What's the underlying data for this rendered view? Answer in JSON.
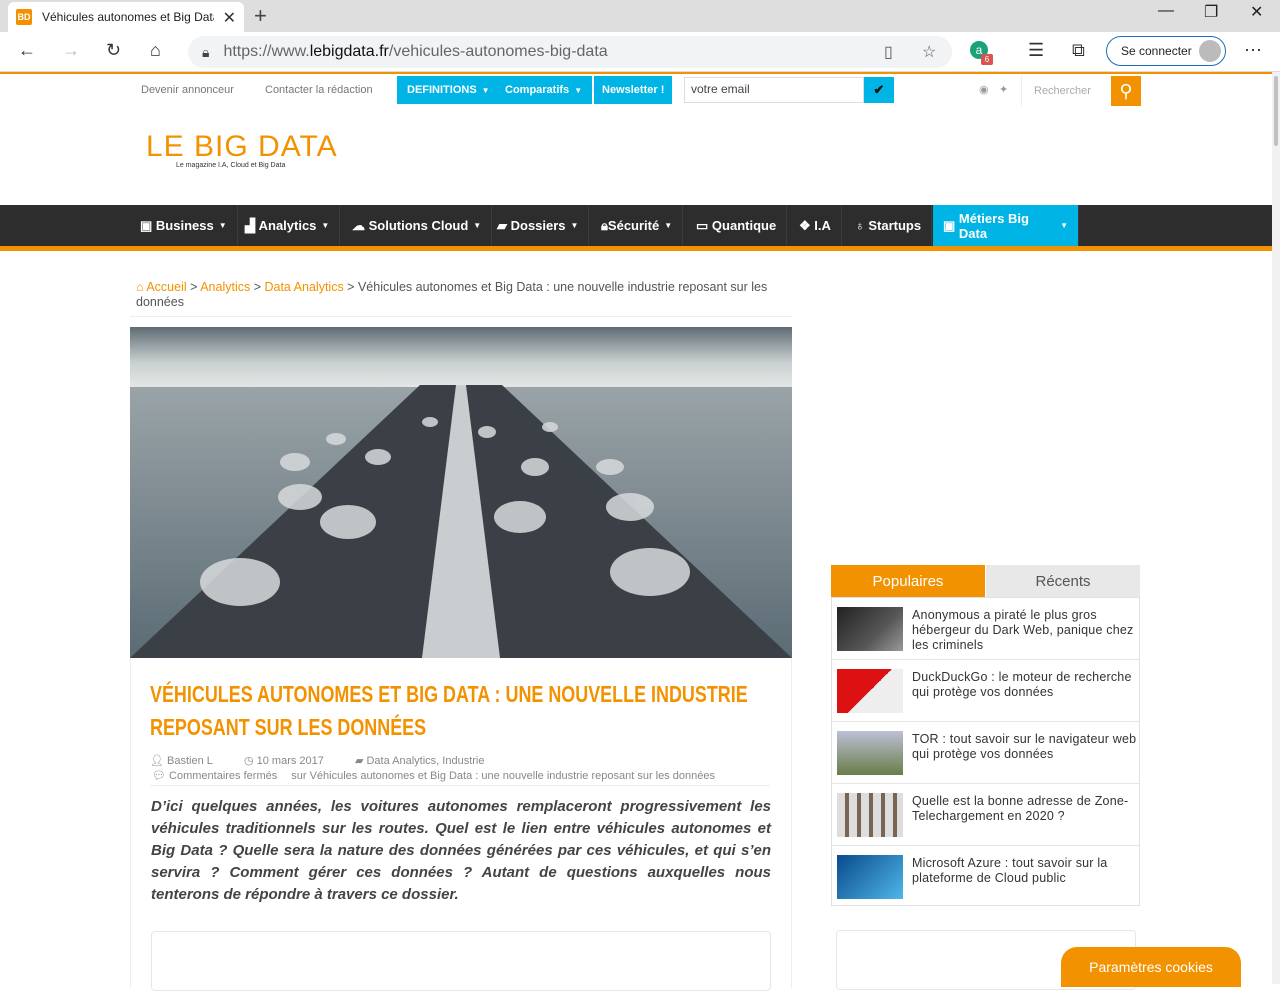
{
  "browser": {
    "tab_title": "Véhicules autonomes et Big Data",
    "favicon_text": "BD",
    "url_prefix": "https://www.",
    "url_domain": "lebigdata.fr",
    "url_path": "/vehicules-autonomes-big-data",
    "signin_label": "Se connecter",
    "extension_badge": "6"
  },
  "topbar": {
    "links": [
      "Devenir annonceur",
      "Contacter la rédaction"
    ],
    "definitions_label": "DEFINITIONS",
    "comparatifs_label": "Comparatifs",
    "newsletter_label": "Newsletter !",
    "email_value": "votre email",
    "search_placeholder": "Rechercher"
  },
  "logo": {
    "name": "LE BIG DATA",
    "tagline": "Le magazine I.A, Cloud et Big Data"
  },
  "mainnav": [
    "Business",
    "Analytics",
    "Solutions Cloud",
    "Dossiers",
    "Sécurité",
    "Quantique",
    "I.A",
    "Startups",
    "Métiers Big Data"
  ],
  "breadcrumb": {
    "home": "Accueil",
    "level1": "Analytics",
    "level2": "Data Analytics",
    "current": "Véhicules autonomes et Big Data : une nouvelle industrie reposant sur les données"
  },
  "article": {
    "title": "Véhicules autonomes et Big Data : une nouvelle industrie reposant sur les données",
    "author": "Bastien L",
    "date": "10 mars 2017",
    "categories": "Data Analytics, Industrie",
    "comments": "Commentaires fermés",
    "comments_suffix": "sur Véhicules autonomes et Big Data : une nouvelle industrie reposant sur les données",
    "lead": "D’ici quelques années, les voitures autonomes remplaceront progressivement les véhicules traditionnels sur les routes. Quel est le lien entre véhicules autonomes et Big Data ? Quelle sera la nature des données générées par ces véhicules, et qui s’en servira ? Comment gérer ces données ? Autant de questions auxquelles nous tenterons de répondre à travers ce dossier."
  },
  "sidebar": {
    "tab_popular": "Populaires",
    "tab_recent": "Récents",
    "items": [
      "Anonymous a piraté le plus gros hébergeur du Dark Web, panique chez les criminels",
      "DuckDuckGo : le moteur de recherche qui protège vos données",
      "TOR : tout savoir sur le navigateur web qui protège vos données",
      "Quelle est la bonne adresse de Zone-Telechargement en 2020 ?",
      "Microsoft Azure : tout savoir sur la plateforme de Cloud public"
    ]
  },
  "cookie_button": "Paramètres cookies",
  "colors": {
    "accent": "#f39200",
    "blue": "#00b4e5",
    "nav_bg": "#2d2d2d"
  }
}
